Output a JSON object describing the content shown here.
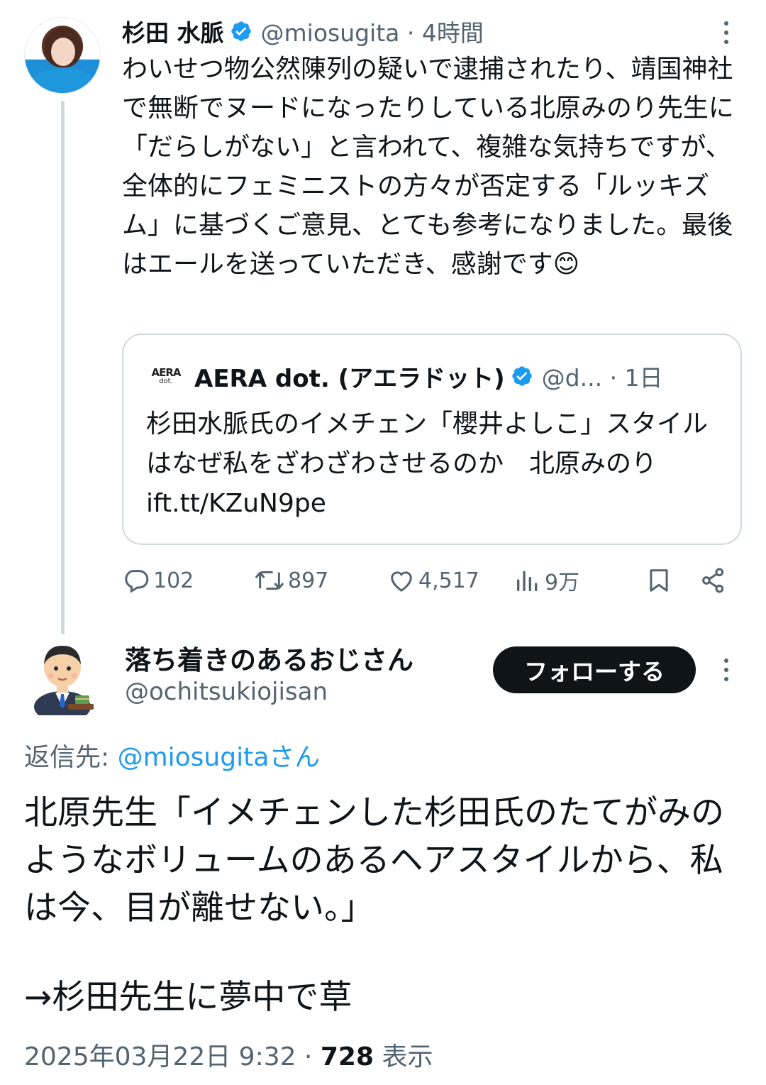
{
  "tweet1": {
    "author_name": "杉田 水脈",
    "handle": "@miosugita",
    "sep": " · ",
    "time": "4時間",
    "text": "わいせつ物公然陳列の疑いで逮捕されたり、靖国神社で無断でヌードになったりしている北原みのり先生に「だらしがない」と言われて、複雑な気持ちですが、全体的にフェミニストの方々が否定する「ルッキズム」に基づくご意見、とても参考になりました。最後はエールを送っていただき、感謝です😊",
    "quote": {
      "logo_line1": "AERA",
      "logo_line2": "dot.",
      "author_name": "AERA dot. (アエラドット)",
      "handle": "@d...",
      "sep": " · ",
      "time": "1日",
      "text": "杉田水脈氏のイメチェン「櫻井よしこ」スタイルはなぜ私をざわざわさせるのか　北原みのり ift.tt/KZuN9pe"
    },
    "stats": {
      "replies": "102",
      "retweets": "897",
      "likes": "4,517",
      "views": "9万"
    }
  },
  "tweet2": {
    "author_name": "落ち着きのあるおじさん",
    "handle": "@ochitsukiojisan",
    "follow_label": "フォローする",
    "reply_prefix": "返信先: ",
    "reply_mention": "@miosugitaさん",
    "text_line1": "北原先生「イメチェンした杉田氏のたてがみのようなボリュームのあるヘアスタイルから、私は今、目が離せない。」",
    "text_line2": "→杉田先生に夢中で草",
    "date": "2025年03月22日 9:32",
    "sep": " · ",
    "views": "728",
    "views_label": " 表示"
  },
  "colors": {
    "text": "#0f1419",
    "secondary": "#536471",
    "link": "#1d9bf0",
    "verified": "#1d9bf0",
    "border": "#cfd9de"
  },
  "icons": [
    "verified-badge-icon",
    "reply-icon",
    "retweet-icon",
    "like-icon",
    "views-icon",
    "bookmark-icon",
    "share-icon",
    "more-icon"
  ]
}
